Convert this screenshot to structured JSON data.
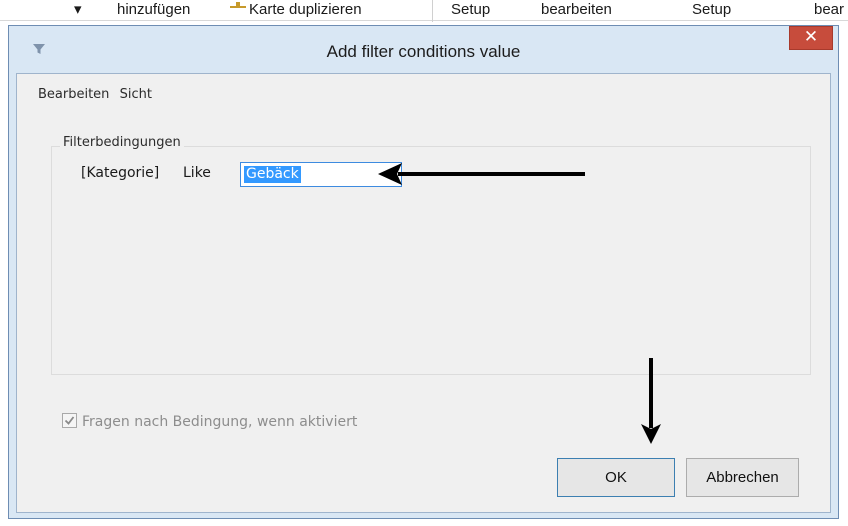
{
  "background_ribbon": {
    "items": [
      "▾",
      "hinzufügen",
      "Karte duplizieren",
      "Setup",
      "bearbeiten",
      "Setup",
      "bear"
    ]
  },
  "dialog": {
    "title": "Add filter conditions  value",
    "close_label": "✕",
    "menu": [
      "Bearbeiten",
      "Sicht"
    ],
    "group_label": "Filterbedingungen",
    "condition": {
      "field": "[Kategorie]",
      "operator": "Like",
      "value": "Gebäck"
    },
    "ask_checkbox": {
      "label": "Fragen nach Bedingung, wenn aktiviert",
      "checked": true,
      "enabled": false
    },
    "buttons": {
      "ok": "OK",
      "cancel": "Abbrechen"
    }
  },
  "colors": {
    "dialog_frame": "#d9e7f4",
    "close_button": "#c74c3c",
    "selection": "#3399ff",
    "annotation_arrow": "#000000"
  },
  "icons": {
    "title": "filter-funnel-icon",
    "close": "close-icon",
    "check": "checkmark-icon"
  }
}
